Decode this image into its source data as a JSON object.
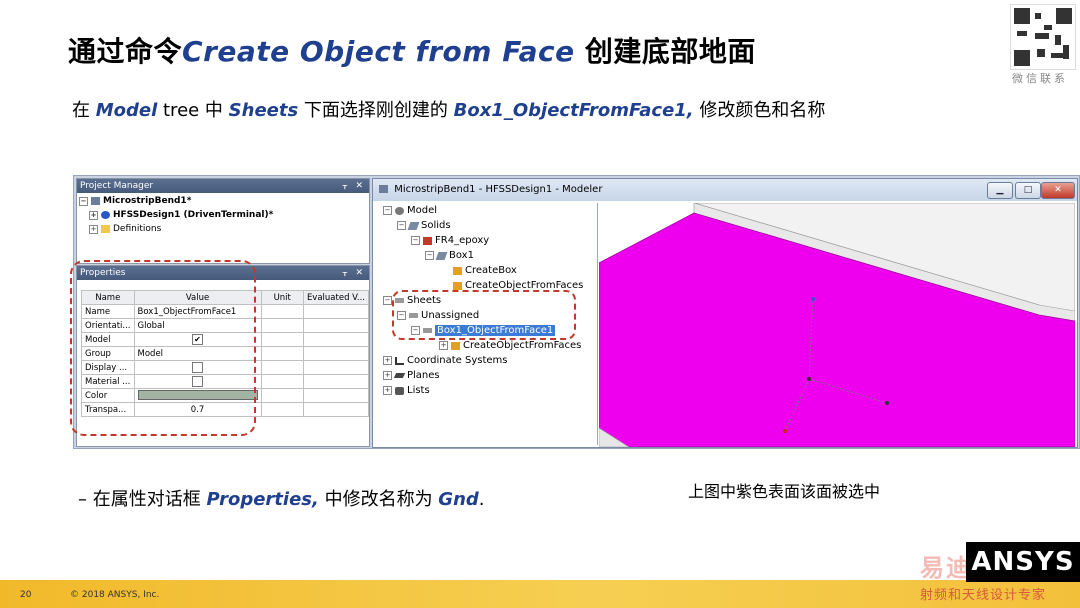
{
  "title": {
    "prefix": "通过命令",
    "command": "Create Object from Face",
    "suffix": "创建底部地面"
  },
  "subtitle": {
    "p1": "在 ",
    "k1": "Model",
    "p2": " tree 中 ",
    "k2": "Sheets",
    "p3": " 下面选择刚创建的 ",
    "k3": "Box1_ObjectFromFace1,",
    "p4": " 修改颜色和名称"
  },
  "qr_caption": "微信联系",
  "project_manager": {
    "title": "Project Manager",
    "items": [
      "MicrostripBend1*",
      "HFSSDesign1 (DrivenTerminal)*",
      "Definitions"
    ]
  },
  "properties": {
    "title": "Properties",
    "columns": [
      "Name",
      "Value",
      "Unit",
      "Evaluated V..."
    ],
    "rows": [
      {
        "name": "Name",
        "value": "Box1_ObjectFromFace1"
      },
      {
        "name": "Orientati...",
        "value": "Global"
      },
      {
        "name": "Model",
        "value": "✔"
      },
      {
        "name": "Group",
        "value": "Model"
      },
      {
        "name": "Display ...",
        "value": ""
      },
      {
        "name": "Material ...",
        "value": ""
      },
      {
        "name": "Color",
        "value": ""
      },
      {
        "name": "Transpa...",
        "value": "0.7"
      }
    ]
  },
  "modeler": {
    "title": "MicrostripBend1 - HFSSDesign1 - Modeler",
    "tree": [
      "Model",
      "Solids",
      "FR4_epoxy",
      "Box1",
      "CreateBox",
      "CreateObjectFromFaces",
      "Sheets",
      "Unassigned",
      "Box1_ObjectFromFace1",
      "CreateObjectFromFaces",
      "Coordinate Systems",
      "Planes",
      "Lists"
    ]
  },
  "bullet": {
    "dash": "– 在属性对话框 ",
    "k1": "Properties,",
    "mid": " 中修改名称为 ",
    "k2": "Gnd",
    "end": "."
  },
  "note": "上图中紫色表面该面被选中",
  "footer": {
    "page": "20",
    "copyright": "© 2018 ANSYS, Inc.",
    "logo": "ANSYS"
  },
  "watermark": {
    "line1": "易迪拓培训",
    "line2": "射频和天线设计专家"
  },
  "colors": {
    "accent": "#1f3f8f",
    "highlight": "#c0392b",
    "magenta": "#ee00ee",
    "footer": "#f3c03a"
  }
}
